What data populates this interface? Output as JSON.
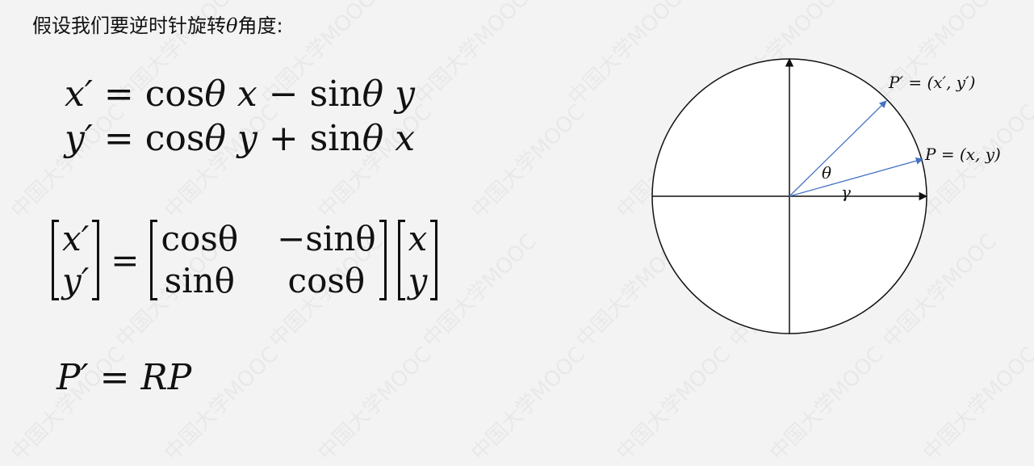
{
  "heading": {
    "text_before": "假设我们要逆时针旋转",
    "theta": "θ",
    "text_after": "角度:"
  },
  "equations": {
    "eq1": {
      "lhs": "x′",
      "eq": "=",
      "cos": "cos",
      "theta1": "θ",
      "x": "x",
      "minus": "−",
      "sin": "sin",
      "theta2": "θ",
      "y": "y"
    },
    "eq2": {
      "lhs": "y′",
      "eq": "=",
      "cos": "cos",
      "theta1": "θ",
      "y": "y",
      "plus": "+",
      "sin": "sin",
      "theta2": "θ",
      "x": "x"
    },
    "matrix": {
      "lhs": [
        "x′",
        "y′"
      ],
      "eq": "=",
      "rotation": [
        [
          "cosθ",
          "−sinθ"
        ],
        [
          "sinθ",
          "cosθ"
        ]
      ],
      "rhs": [
        "x",
        "y"
      ]
    },
    "eq4": {
      "lhs": "P′",
      "eq": "=",
      "rhs": "RP"
    }
  },
  "diagram": {
    "label_p_prime": "P′ = (x′, y′)",
    "label_p": "P = (x, y)",
    "label_theta": "θ",
    "label_gamma": "γ",
    "vector_color": "#4472c4",
    "axis_color": "#111111"
  },
  "watermark": "中国大学MOOC"
}
